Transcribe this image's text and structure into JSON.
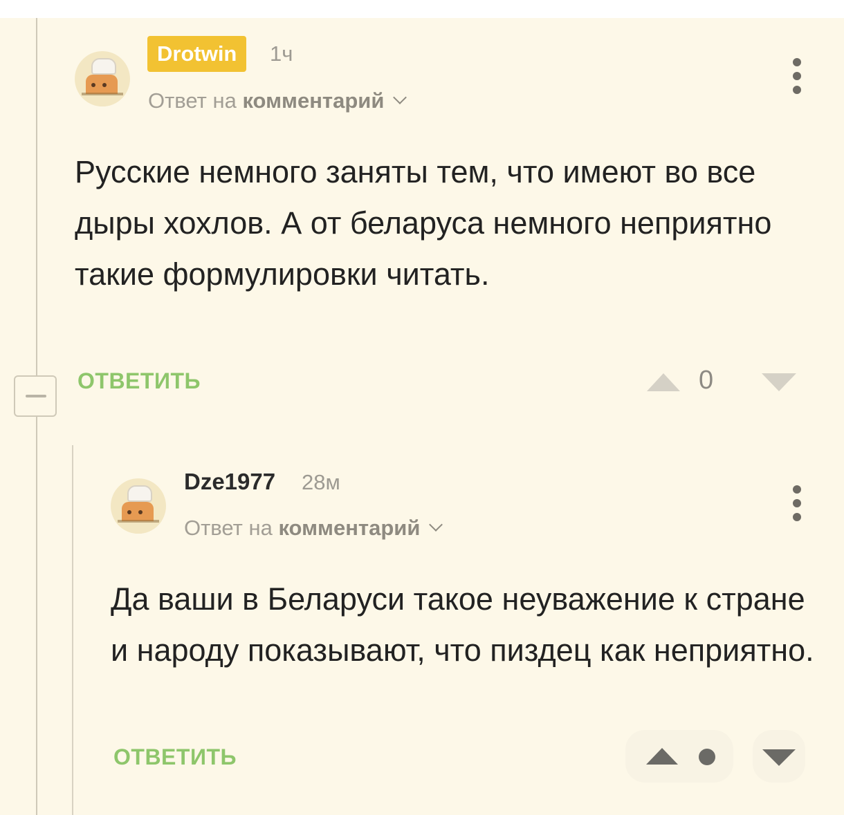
{
  "comments": [
    {
      "author": "Drotwin",
      "time": "1ч",
      "reply_to_prefix": "Ответ на",
      "reply_to_link": "комментарий",
      "body": "Русские немного заняты тем, что имеют во все дыры хохлов. А от беларуса немного неприятно такие формулировки читать.",
      "reply_label": "ОТВЕТИТЬ",
      "score": "0",
      "icons": {
        "avatar": "chef-avatar",
        "menu": "more-vertical-icon",
        "upvote": "arrow-up-icon",
        "downvote": "arrow-down-icon"
      }
    },
    {
      "author": "Dze1977",
      "time": "28м",
      "reply_to_prefix": "Ответ на",
      "reply_to_link": "комментарий",
      "body": "Да ваши в Беларуси такое неуважение к стране и народу показывают, что пиздец как неприятно.",
      "reply_label": "ОТВЕТИТЬ",
      "score": "",
      "icons": {
        "avatar": "chef-avatar",
        "menu": "more-vertical-icon",
        "upvote": "arrow-up-icon",
        "downvote": "arrow-down-icon"
      }
    }
  ],
  "colors": {
    "background": "#fdf8e8",
    "author_badge": "#f2c232",
    "reply_green": "#8ec66b",
    "thread_line": "#cfc9b8"
  }
}
